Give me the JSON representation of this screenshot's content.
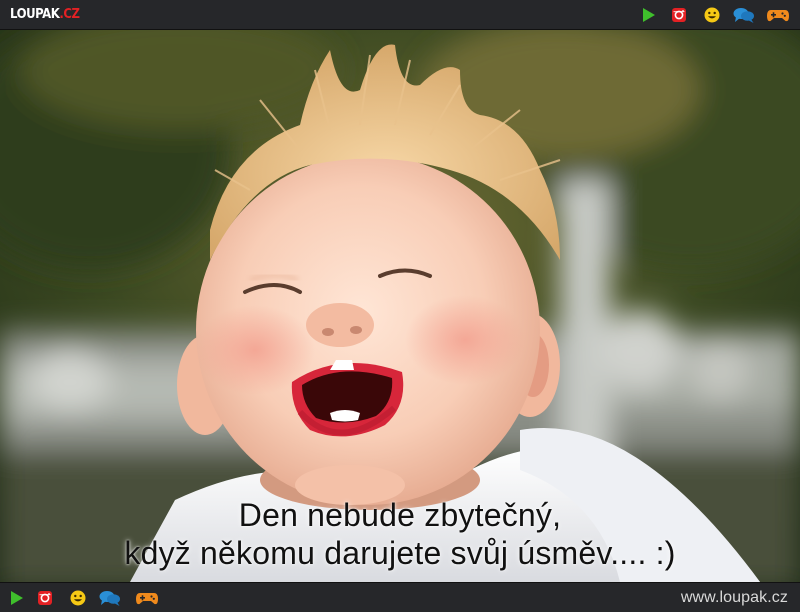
{
  "header": {
    "logo": {
      "main": "LOUPAK",
      "dot": ".",
      "tld": "CZ"
    },
    "icons": [
      {
        "name": "play-icon",
        "color": "#3fbf2c"
      },
      {
        "name": "instagram-icon",
        "color": "#e32124"
      },
      {
        "name": "smiley-icon",
        "color": "#f6c915"
      },
      {
        "name": "chat-icon",
        "color": "#2a8fd6"
      },
      {
        "name": "gamepad-icon",
        "color": "#f08a1c"
      }
    ]
  },
  "content": {
    "caption_line1": "Den nebude zbytečný,",
    "caption_line2": "když někomu darujete svůj úsměv.... :)"
  },
  "footer": {
    "site_url": "www.loupak.cz",
    "icons": [
      {
        "name": "play-icon",
        "color": "#3fbf2c"
      },
      {
        "name": "instagram-icon",
        "color": "#e32124"
      },
      {
        "name": "smiley-icon",
        "color": "#f6c915"
      },
      {
        "name": "chat-icon",
        "color": "#2a8fd6"
      },
      {
        "name": "gamepad-icon",
        "color": "#f08a1c"
      }
    ]
  },
  "colors": {
    "bar_background": "#26272a",
    "brand_red": "#e32124"
  }
}
